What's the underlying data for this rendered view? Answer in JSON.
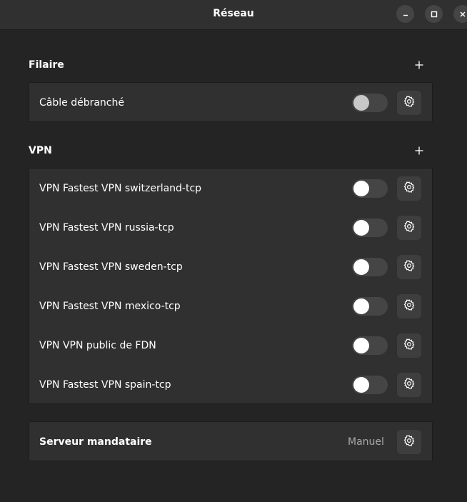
{
  "window": {
    "title": "Réseau",
    "controls": [
      "minimize-icon",
      "maximize-icon",
      "close-icon"
    ]
  },
  "sections": {
    "wired": {
      "title": "Filaire",
      "add_icon": "plus-icon",
      "items": [
        {
          "label": "Câble débranché",
          "toggle_on": false,
          "toggle_enabled": false,
          "action_icon": "gear-icon"
        }
      ]
    },
    "vpn": {
      "title": "VPN",
      "add_icon": "plus-icon",
      "items": [
        {
          "label": "VPN Fastest VPN switzerland-tcp",
          "toggle_on": false,
          "action_icon": "gear-icon"
        },
        {
          "label": "VPN Fastest VPN russia-tcp",
          "toggle_on": false,
          "action_icon": "gear-icon"
        },
        {
          "label": "VPN Fastest VPN sweden-tcp",
          "toggle_on": false,
          "action_icon": "gear-icon"
        },
        {
          "label": "VPN Fastest VPN mexico-tcp",
          "toggle_on": false,
          "action_icon": "gear-icon"
        },
        {
          "label": "VPN VPN public de FDN",
          "toggle_on": false,
          "action_icon": "gear-icon"
        },
        {
          "label": "VPN Fastest VPN spain-tcp",
          "toggle_on": false,
          "action_icon": "gear-icon"
        }
      ]
    },
    "proxy": {
      "label": "Serveur mandataire",
      "value": "Manuel",
      "action_icon": "gear-icon"
    }
  },
  "colors": {
    "window_bg": "#242424",
    "titlebar_bg": "#303030",
    "card_bg": "#303030",
    "toggle_track": "#454545",
    "button_bg": "#3e3e3e",
    "secondary_text": "#a8a8a8"
  }
}
